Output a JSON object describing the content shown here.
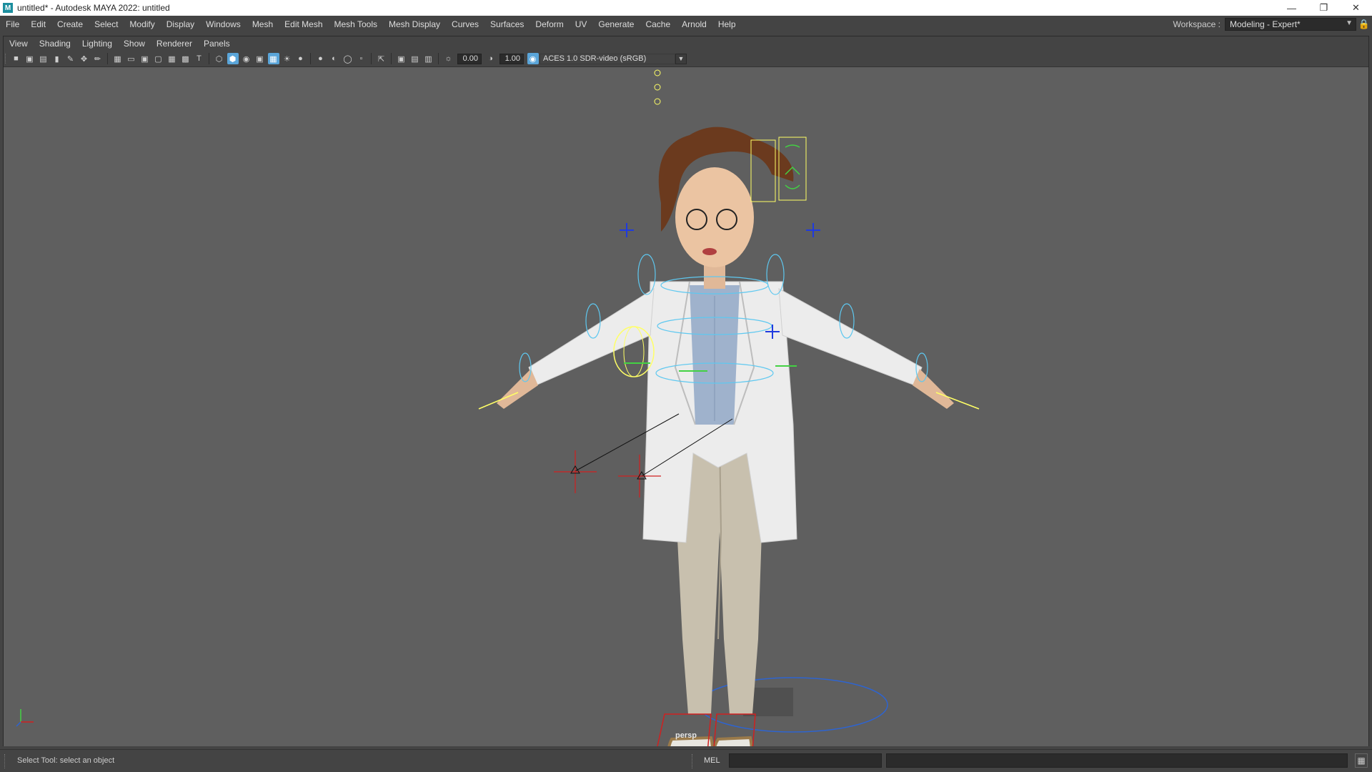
{
  "window": {
    "title": "untitled* - Autodesk MAYA 2022: untitled",
    "logo_letter": "M",
    "controls": [
      "minimize",
      "maximize",
      "close"
    ]
  },
  "main_menu": [
    "File",
    "Edit",
    "Create",
    "Select",
    "Modify",
    "Display",
    "Windows",
    "Mesh",
    "Edit Mesh",
    "Mesh Tools",
    "Mesh Display",
    "Curves",
    "Surfaces",
    "Deform",
    "UV",
    "Generate",
    "Cache",
    "Arnold",
    "Help"
  ],
  "workspace": {
    "label": "Workspace :",
    "value": "Modeling - Expert*"
  },
  "panel_menu": [
    "View",
    "Shading",
    "Lighting",
    "Show",
    "Renderer",
    "Panels"
  ],
  "toolbar": {
    "exposure": "0.00",
    "gamma": "1.00",
    "color_space": "ACES 1.0 SDR-video (sRGB)"
  },
  "viewport": {
    "camera": "persp",
    "background_color": "#5f5f5f",
    "selected_control_color": "#ffff66",
    "control_curve_color": "#5ec8f0",
    "ik_handle_color": "#d02020"
  },
  "helpline": {
    "text": "Select Tool: select an object"
  },
  "command_line": {
    "language": "MEL"
  }
}
